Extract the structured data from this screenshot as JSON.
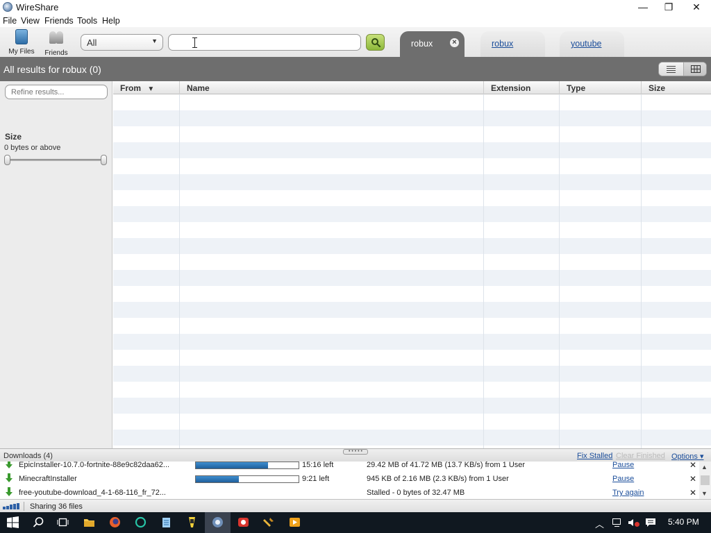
{
  "app": {
    "title": "WireShare"
  },
  "window_controls": {
    "minimize": "—",
    "restore": "❐",
    "close": "✕"
  },
  "menu": [
    "File",
    "View",
    "Friends",
    "Tools",
    "Help"
  ],
  "toolbar": {
    "my_files_label": "My Files",
    "friends_label": "Friends",
    "category_select": "All",
    "search_value": "",
    "search_placeholder": ""
  },
  "tabs": [
    {
      "label": "robux",
      "active": true
    },
    {
      "label": "robux",
      "active": false
    },
    {
      "label": "youtube",
      "active": false
    }
  ],
  "results": {
    "title": "All results for robux (0)"
  },
  "filters": {
    "refine_placeholder": "Refine results...",
    "size_title": "Size",
    "size_range": "0 bytes or above"
  },
  "table": {
    "columns": [
      "From",
      "Name",
      "Extension",
      "Type",
      "Size"
    ],
    "sort_indicator": "▼"
  },
  "downloads": {
    "title": "Downloads (4)",
    "fix_stalled": "Fix Stalled",
    "clear_finished": "Clear Finished",
    "options": "Options ▾",
    "items": [
      {
        "name": "EpicInstaller-10.7.0-fortnite-88e9c82daa62...",
        "progress": 0.7,
        "time": "15:16 left",
        "status": "29.42 MB of 41.72 MB (13.7 KB/s) from 1 User",
        "action": "Pause"
      },
      {
        "name": "MinecraftInstaller",
        "progress": 0.42,
        "time": "9:21 left",
        "status": "945 KB of 2.16 MB (2.3 KB/s) from 1 User",
        "action": "Pause"
      },
      {
        "name": "free-youtube-download_4-1-68-116_fr_72...",
        "progress": null,
        "time": "",
        "status": "Stalled - 0 bytes of 32.47 MB",
        "action": "Try again"
      }
    ]
  },
  "status": {
    "sharing": "Sharing 36 files"
  },
  "taskbar": {
    "clock": "5:40 PM"
  },
  "colors": {
    "header_gray": "#6e6e6e",
    "link_blue": "#1a4d9a",
    "progress_blue": "#2a72b8",
    "search_green": "#9bc64a",
    "row_stripe": "#eef2f7"
  }
}
